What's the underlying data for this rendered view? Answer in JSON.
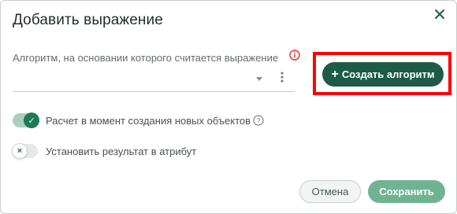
{
  "dialog": {
    "title": "Добавить выражение",
    "close_icon": "close-icon"
  },
  "algorithm_field": {
    "label": "Алгоритм, на основании которого считается выражение",
    "value": "",
    "info_icon": "info-circle-icon",
    "status_color": "#d9322c"
  },
  "create_algorithm": {
    "label": "Создать алгоритм",
    "icon": "plus-icon",
    "highlight_color": "#ff0000"
  },
  "toggles": [
    {
      "label": "Расчет в момент создания новых объектов",
      "enabled": true,
      "help_icon": "question-circle-icon"
    },
    {
      "label": "Установить результат в атрибут",
      "enabled": false
    }
  ],
  "actions": {
    "cancel_label": "Отмена",
    "save_label": "Сохранить"
  },
  "colors": {
    "primary": "#1e5b47",
    "save_disabled": "#6fb393"
  }
}
